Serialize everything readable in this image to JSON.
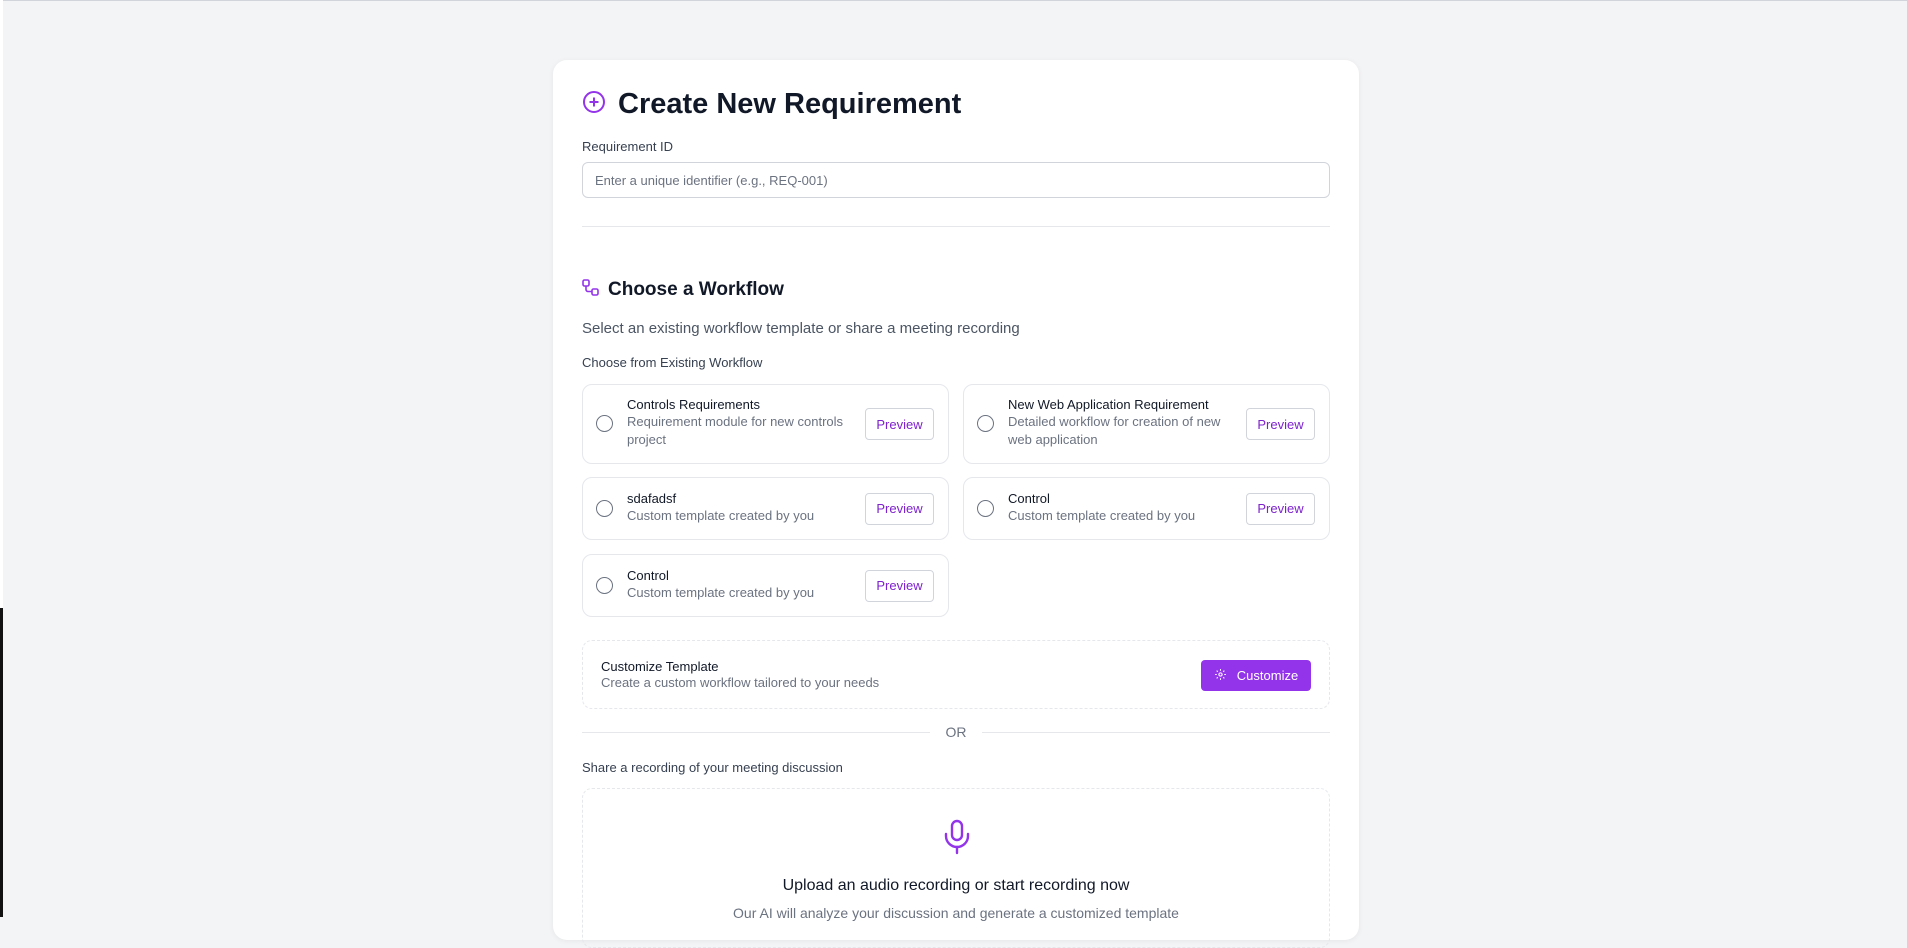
{
  "header": {
    "title": "Create New Requirement",
    "icon": "plus-circle-icon"
  },
  "requirement": {
    "label": "Requirement ID",
    "placeholder": "Enter a unique identifier (e.g., REQ-001)",
    "value": ""
  },
  "workflow": {
    "title": "Choose a Workflow",
    "icon": "workflow-icon",
    "subtitle": "Select an existing workflow template or share a meeting recording",
    "existing_label": "Choose from Existing Workflow",
    "preview_label": "Preview",
    "options": [
      {
        "name": "Controls Requirements",
        "description": "Requirement module for new controls project",
        "selected": false
      },
      {
        "name": "New Web Application Requirement",
        "description": "Detailed workflow for creation of new web application",
        "selected": false
      },
      {
        "name": "sdafadsf",
        "description": "Custom template created by you",
        "selected": false
      },
      {
        "name": "Control",
        "description": "Custom template created by you",
        "selected": false
      },
      {
        "name": "Control",
        "description": "Custom template created by you",
        "selected": false
      }
    ]
  },
  "customize": {
    "title": "Customize Template",
    "description": "Create a custom workflow tailored to your needs",
    "button_label": "Customize",
    "button_icon": "gear-icon"
  },
  "separator": {
    "text": "OR"
  },
  "recording": {
    "label": "Share a recording of your meeting discussion",
    "icon": "microphone-icon",
    "title": "Upload an audio recording or start recording now",
    "description": "Our AI will analyze your discussion and generate a customized template"
  },
  "colors": {
    "accent": "#9333ea",
    "accent_text": "#7e22ce",
    "background": "#f3f4f6"
  }
}
